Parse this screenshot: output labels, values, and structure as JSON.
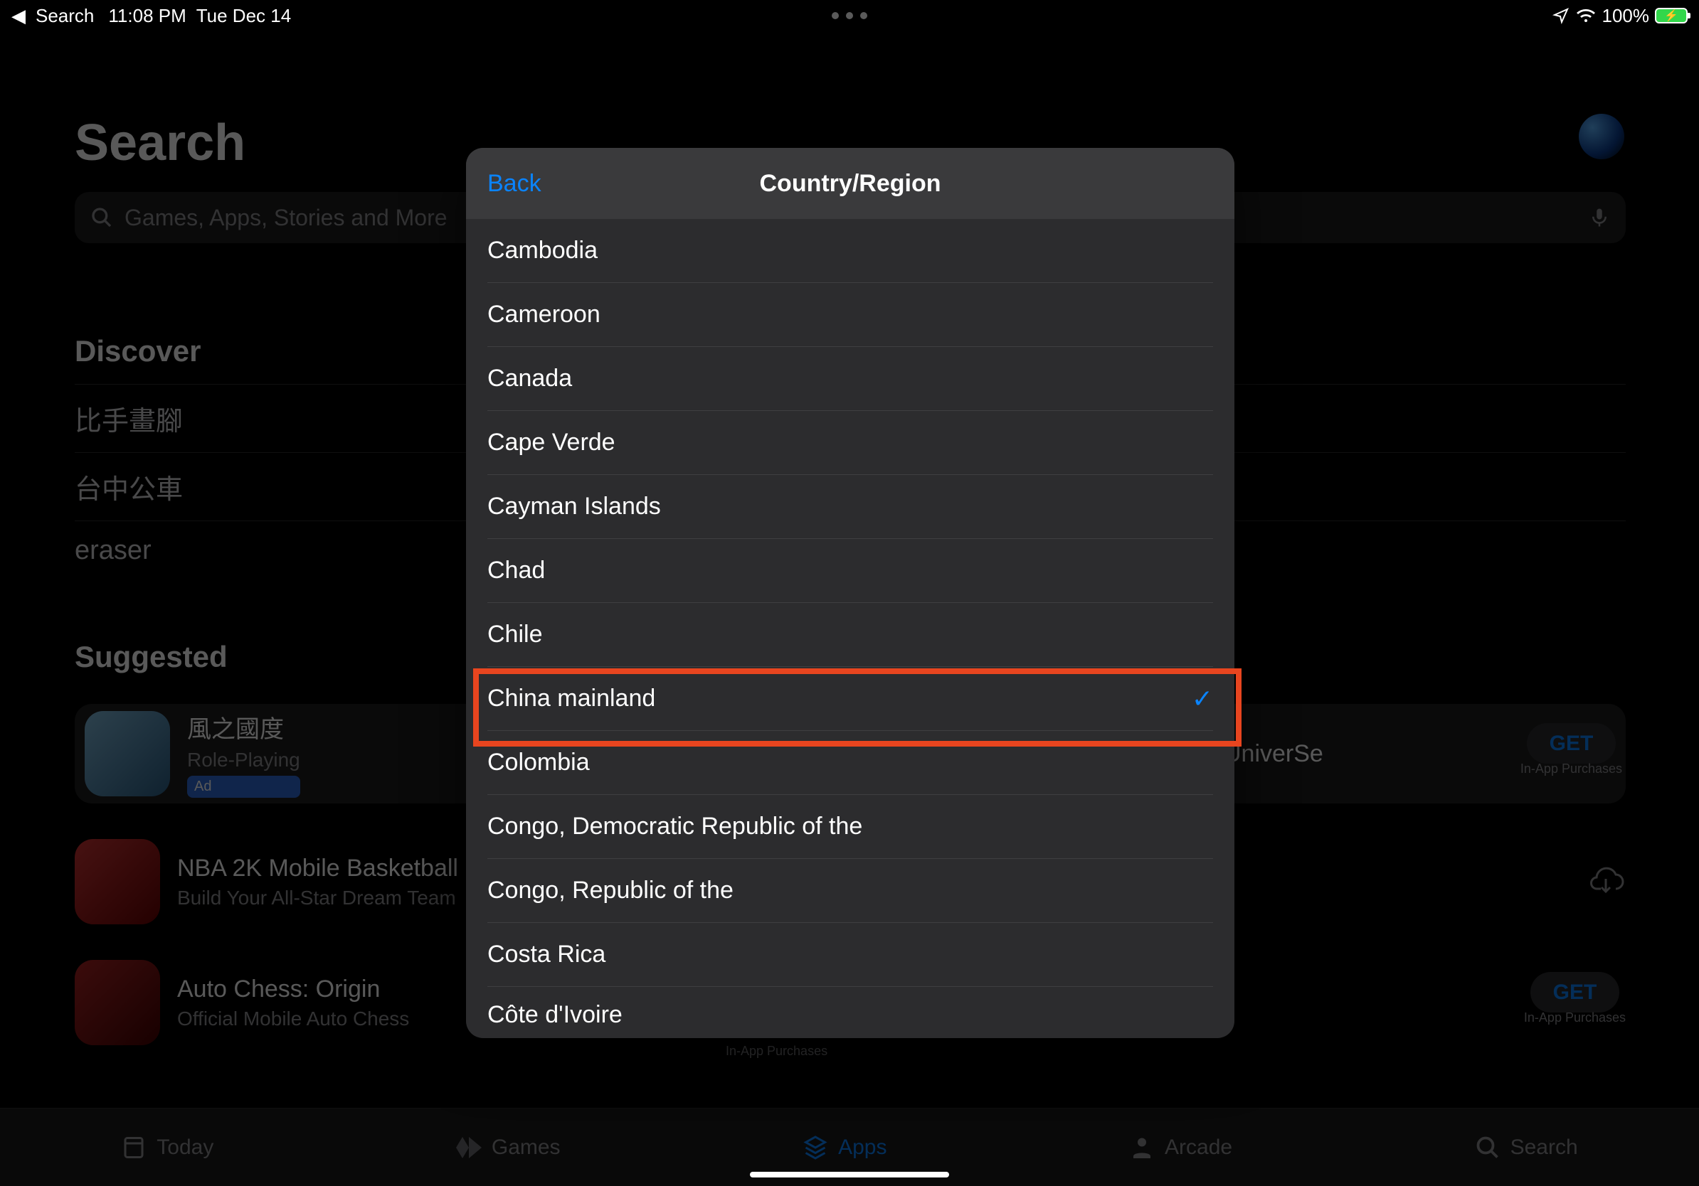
{
  "status": {
    "back_app": "Search",
    "time": "11:08 PM",
    "date": "Tue Dec 14",
    "battery_pct": "100%"
  },
  "page": {
    "title": "Search",
    "search_placeholder": "Games, Apps, Stories and More",
    "discover_title": "Discover",
    "discover_items": [
      "比手畫腳",
      "台中公車",
      "eraser"
    ],
    "suggested_title": "Suggested",
    "apps": [
      {
        "name": "風之國度",
        "sub": "Role-Playing",
        "action": "ad",
        "ad_label": "Ad",
        "iap": ""
      },
      {
        "name": "NBA 2K Mobile Basketball",
        "sub": "Build Your All-Star Dream Team",
        "action": "cloud",
        "iap": ""
      },
      {
        "name": "Auto Chess: Origin",
        "sub": "Official Mobile Auto Chess",
        "action": "get",
        "get_label": "GET",
        "iap": "In-App Purchases"
      }
    ],
    "right_apps": [
      {
        "name": "UniverSe",
        "action": "get",
        "get_label": "GET",
        "iap": "In-App Purchases"
      }
    ],
    "iap_text": "In-App Purchases"
  },
  "tabs": [
    {
      "label": "Today",
      "active": false
    },
    {
      "label": "Games",
      "active": false
    },
    {
      "label": "Apps",
      "active": true
    },
    {
      "label": "Arcade",
      "active": false
    },
    {
      "label": "Search",
      "active": false
    }
  ],
  "modal": {
    "back": "Back",
    "title": "Country/Region",
    "items": [
      {
        "label": "Cambodia",
        "selected": false
      },
      {
        "label": "Cameroon",
        "selected": false
      },
      {
        "label": "Canada",
        "selected": false
      },
      {
        "label": "Cape Verde",
        "selected": false
      },
      {
        "label": "Cayman Islands",
        "selected": false
      },
      {
        "label": "Chad",
        "selected": false
      },
      {
        "label": "Chile",
        "selected": false
      },
      {
        "label": "China mainland",
        "selected": true
      },
      {
        "label": "Colombia",
        "selected": false
      },
      {
        "label": "Congo, Democratic Republic of the",
        "selected": false
      },
      {
        "label": "Congo, Republic of the",
        "selected": false
      },
      {
        "label": "Costa Rica",
        "selected": false
      },
      {
        "label": "Côte d'Ivoire",
        "selected": false
      }
    ]
  }
}
